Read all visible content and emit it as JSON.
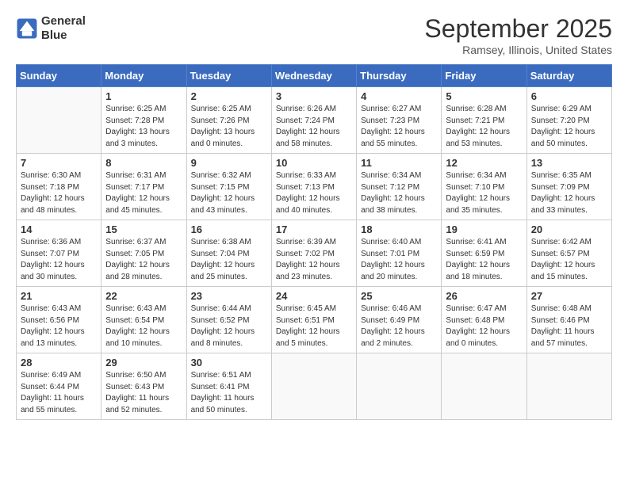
{
  "header": {
    "logo_line1": "General",
    "logo_line2": "Blue",
    "title": "September 2025",
    "subtitle": "Ramsey, Illinois, United States"
  },
  "days_of_week": [
    "Sunday",
    "Monday",
    "Tuesday",
    "Wednesday",
    "Thursday",
    "Friday",
    "Saturday"
  ],
  "weeks": [
    [
      {
        "day": "",
        "info": ""
      },
      {
        "day": "1",
        "info": "Sunrise: 6:25 AM\nSunset: 7:28 PM\nDaylight: 13 hours\nand 3 minutes."
      },
      {
        "day": "2",
        "info": "Sunrise: 6:25 AM\nSunset: 7:26 PM\nDaylight: 13 hours\nand 0 minutes."
      },
      {
        "day": "3",
        "info": "Sunrise: 6:26 AM\nSunset: 7:24 PM\nDaylight: 12 hours\nand 58 minutes."
      },
      {
        "day": "4",
        "info": "Sunrise: 6:27 AM\nSunset: 7:23 PM\nDaylight: 12 hours\nand 55 minutes."
      },
      {
        "day": "5",
        "info": "Sunrise: 6:28 AM\nSunset: 7:21 PM\nDaylight: 12 hours\nand 53 minutes."
      },
      {
        "day": "6",
        "info": "Sunrise: 6:29 AM\nSunset: 7:20 PM\nDaylight: 12 hours\nand 50 minutes."
      }
    ],
    [
      {
        "day": "7",
        "info": "Sunrise: 6:30 AM\nSunset: 7:18 PM\nDaylight: 12 hours\nand 48 minutes."
      },
      {
        "day": "8",
        "info": "Sunrise: 6:31 AM\nSunset: 7:17 PM\nDaylight: 12 hours\nand 45 minutes."
      },
      {
        "day": "9",
        "info": "Sunrise: 6:32 AM\nSunset: 7:15 PM\nDaylight: 12 hours\nand 43 minutes."
      },
      {
        "day": "10",
        "info": "Sunrise: 6:33 AM\nSunset: 7:13 PM\nDaylight: 12 hours\nand 40 minutes."
      },
      {
        "day": "11",
        "info": "Sunrise: 6:34 AM\nSunset: 7:12 PM\nDaylight: 12 hours\nand 38 minutes."
      },
      {
        "day": "12",
        "info": "Sunrise: 6:34 AM\nSunset: 7:10 PM\nDaylight: 12 hours\nand 35 minutes."
      },
      {
        "day": "13",
        "info": "Sunrise: 6:35 AM\nSunset: 7:09 PM\nDaylight: 12 hours\nand 33 minutes."
      }
    ],
    [
      {
        "day": "14",
        "info": "Sunrise: 6:36 AM\nSunset: 7:07 PM\nDaylight: 12 hours\nand 30 minutes."
      },
      {
        "day": "15",
        "info": "Sunrise: 6:37 AM\nSunset: 7:05 PM\nDaylight: 12 hours\nand 28 minutes."
      },
      {
        "day": "16",
        "info": "Sunrise: 6:38 AM\nSunset: 7:04 PM\nDaylight: 12 hours\nand 25 minutes."
      },
      {
        "day": "17",
        "info": "Sunrise: 6:39 AM\nSunset: 7:02 PM\nDaylight: 12 hours\nand 23 minutes."
      },
      {
        "day": "18",
        "info": "Sunrise: 6:40 AM\nSunset: 7:01 PM\nDaylight: 12 hours\nand 20 minutes."
      },
      {
        "day": "19",
        "info": "Sunrise: 6:41 AM\nSunset: 6:59 PM\nDaylight: 12 hours\nand 18 minutes."
      },
      {
        "day": "20",
        "info": "Sunrise: 6:42 AM\nSunset: 6:57 PM\nDaylight: 12 hours\nand 15 minutes."
      }
    ],
    [
      {
        "day": "21",
        "info": "Sunrise: 6:43 AM\nSunset: 6:56 PM\nDaylight: 12 hours\nand 13 minutes."
      },
      {
        "day": "22",
        "info": "Sunrise: 6:43 AM\nSunset: 6:54 PM\nDaylight: 12 hours\nand 10 minutes."
      },
      {
        "day": "23",
        "info": "Sunrise: 6:44 AM\nSunset: 6:52 PM\nDaylight: 12 hours\nand 8 minutes."
      },
      {
        "day": "24",
        "info": "Sunrise: 6:45 AM\nSunset: 6:51 PM\nDaylight: 12 hours\nand 5 minutes."
      },
      {
        "day": "25",
        "info": "Sunrise: 6:46 AM\nSunset: 6:49 PM\nDaylight: 12 hours\nand 2 minutes."
      },
      {
        "day": "26",
        "info": "Sunrise: 6:47 AM\nSunset: 6:48 PM\nDaylight: 12 hours\nand 0 minutes."
      },
      {
        "day": "27",
        "info": "Sunrise: 6:48 AM\nSunset: 6:46 PM\nDaylight: 11 hours\nand 57 minutes."
      }
    ],
    [
      {
        "day": "28",
        "info": "Sunrise: 6:49 AM\nSunset: 6:44 PM\nDaylight: 11 hours\nand 55 minutes."
      },
      {
        "day": "29",
        "info": "Sunrise: 6:50 AM\nSunset: 6:43 PM\nDaylight: 11 hours\nand 52 minutes."
      },
      {
        "day": "30",
        "info": "Sunrise: 6:51 AM\nSunset: 6:41 PM\nDaylight: 11 hours\nand 50 minutes."
      },
      {
        "day": "",
        "info": ""
      },
      {
        "day": "",
        "info": ""
      },
      {
        "day": "",
        "info": ""
      },
      {
        "day": "",
        "info": ""
      }
    ]
  ]
}
